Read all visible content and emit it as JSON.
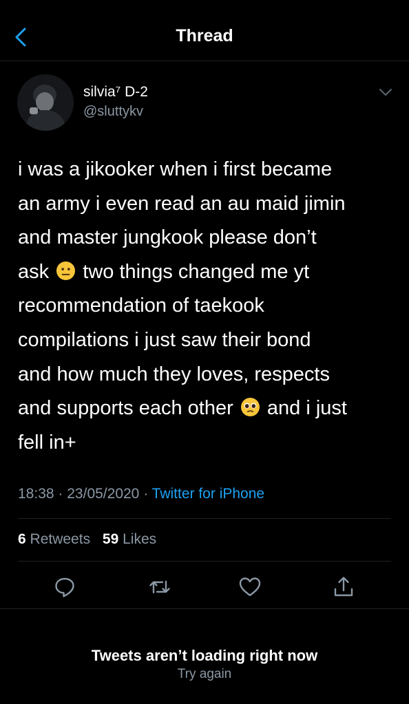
{
  "header": {
    "title": "Thread",
    "back_icon": "chevron-left-icon"
  },
  "colors": {
    "background": "#000000",
    "accent": "#1da1f2",
    "secondary_text": "#8b98a5",
    "divider": "#1f2225"
  },
  "tweet": {
    "author": {
      "display_name": "silvia⁷ D-2",
      "handle": "@sluttykv"
    },
    "menu_icon": "chevron-down-icon",
    "text_lines": [
      "i was a jikooker when i first became",
      "an army i even read an au maid jimin",
      "and master jungkook please don’t",
      "ask",
      "two things changed me yt",
      "recommendation of taekook",
      "compilations i just saw their bond",
      "and how much they loves, respects",
      "and supports each other",
      "and i just",
      "fell in+"
    ],
    "emojis": {
      "first": "neutral-face-emoji",
      "second": "pleading-face-emoji"
    },
    "time": "18:38",
    "date": "23/05/2020",
    "separator": "·",
    "source": "Twitter for iPhone",
    "retweets_count": "6",
    "retweets_label": "Retweets",
    "likes_count": "59",
    "likes_label": "Likes"
  },
  "actions": [
    {
      "name": "reply",
      "icon": "reply-icon"
    },
    {
      "name": "retweet",
      "icon": "retweet-icon"
    },
    {
      "name": "like",
      "icon": "heart-icon"
    },
    {
      "name": "share",
      "icon": "share-icon"
    }
  ],
  "error": {
    "title": "Tweets aren’t loading right now",
    "retry_label": "Try again"
  }
}
